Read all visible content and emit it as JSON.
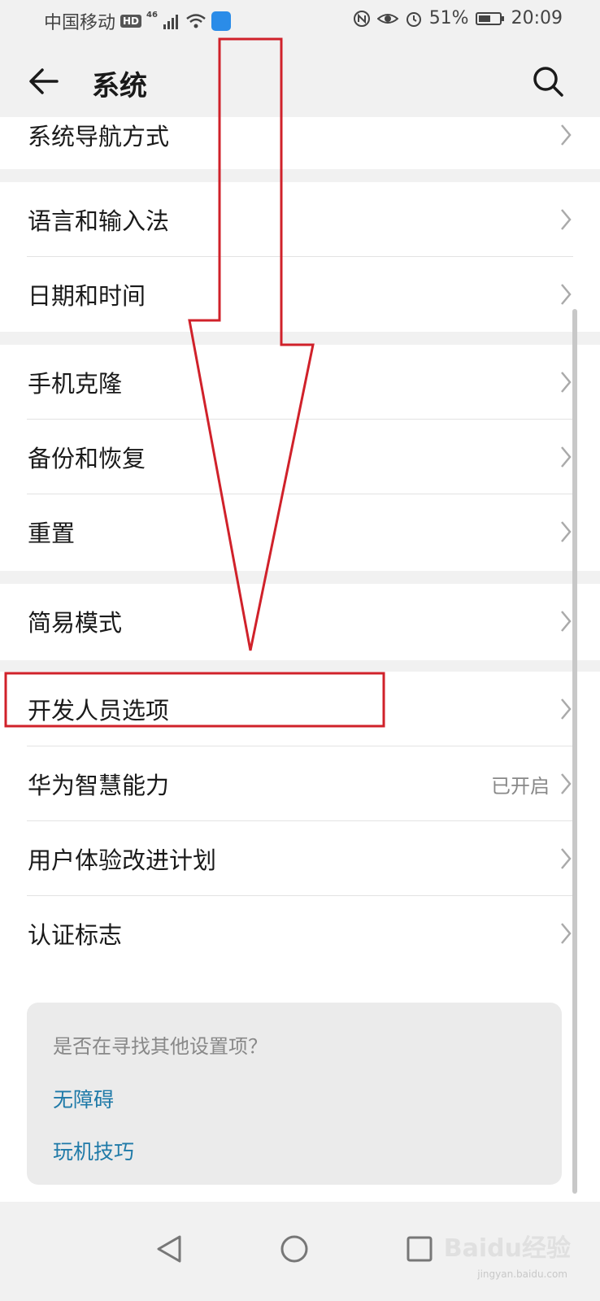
{
  "status": {
    "carrier": "中国移动",
    "hd": "HD",
    "network": "46",
    "battery": "51%",
    "time": "20:09"
  },
  "header": {
    "title": "系统"
  },
  "items": [
    {
      "label": "系统导航方式"
    },
    {
      "label": "语言和输入法"
    },
    {
      "label": "日期和时间"
    },
    {
      "label": "手机克隆"
    },
    {
      "label": "备份和恢复"
    },
    {
      "label": "重置"
    },
    {
      "label": "简易模式"
    },
    {
      "label": "开发人员选项"
    },
    {
      "label": "华为智慧能力",
      "value": "已开启"
    },
    {
      "label": "用户体验改进计划"
    },
    {
      "label": "认证标志"
    }
  ],
  "hint": {
    "question": "是否在寻找其他设置项？",
    "links": [
      "无障碍",
      "玩机技巧"
    ]
  },
  "watermark": {
    "brand": "Baidu经验",
    "sub": "jingyan.baidu.com"
  },
  "colors": {
    "annotation": "#d0212a",
    "link": "#1f7aa8",
    "background": "#f1f1f1"
  }
}
